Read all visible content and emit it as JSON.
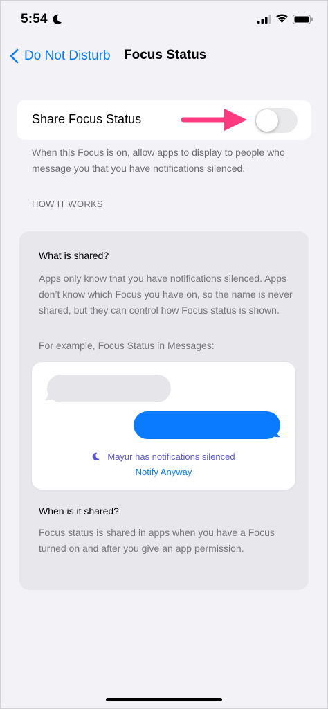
{
  "status_bar": {
    "time": "5:54",
    "icons": [
      "moon-icon",
      "cellular-signal-icon",
      "wifi-icon",
      "battery-icon"
    ]
  },
  "nav": {
    "back_label": "Do Not Disturb",
    "title": "Focus Status"
  },
  "share_toggle": {
    "label": "Share Focus Status",
    "on": false
  },
  "description": "When this Focus is on, allow apps to display to people who message you that you have notifications silenced.",
  "section_header": "HOW IT WORKS",
  "info": {
    "what_heading": "What is shared?",
    "what_text": "Apps only know that you have notifications silenced. Apps don’t know which Focus you have on, so the name is never shared, but they can control how Focus status is shown.",
    "example_text": "For example, Focus Status in Messages:",
    "preview": {
      "silenced_text": "Mayur has notifications silenced",
      "notify_label": "Notify Anyway"
    },
    "when_heading": "When is it shared?",
    "when_text": "Focus status is shared in apps when you have a Focus turned on and after you give an app permission."
  },
  "colors": {
    "accent": "#0a7aff",
    "arrow": "#ff3b7f",
    "focus_purple": "#5856d6"
  }
}
